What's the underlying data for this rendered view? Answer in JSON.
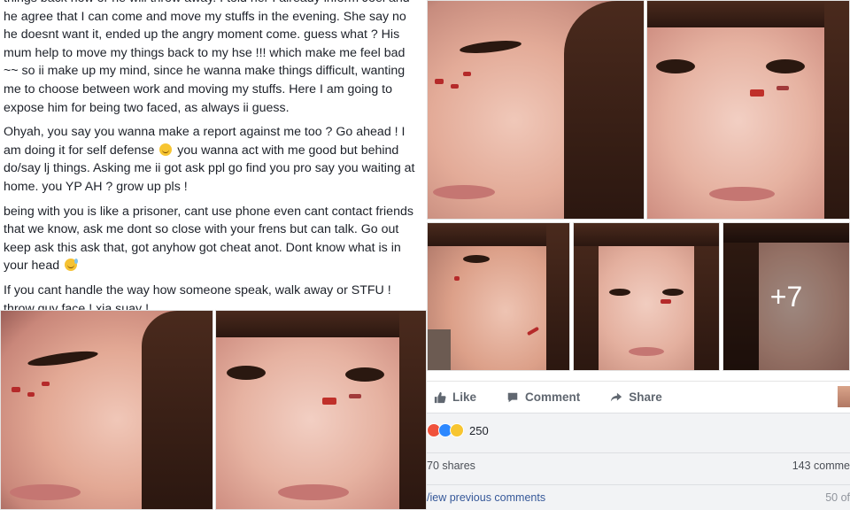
{
  "post": {
    "paragraphs": [
      "things back now or he will throw away. I told her I already inform Joel and he agree that I can come and move my stuffs in the evening. She say no he doesnt want it, ended up the angry moment come. guess what ? His mum help to move my things back to my hse !!! which make me feel bad ~~ so ii make up my mind, since he wanna make things difficult, wanting me to choose between work and moving my stuffs. Here I am going to expose him for being two faced, as always ii guess.",
      "Ohyah, you say you wanna make a report against me too ? Go ahead ! I am doing it for self defense",
      "you wanna act with me good but behind do/say lj things. Asking me ii got ask ppl go find you pro say you waiting at home. you YP AH ? grow up pls !",
      "being with you is like a prisoner, cant use phone even cant contact friends that we know, ask me dont so close with your frens but can talk. Go out keep ask this ask that, got anyhow got cheat anot. Dont know what is in your head",
      "If you cant handle the way how someone speak, walk away or STFU ! throw guy face ! xia suay !"
    ]
  },
  "gallery": {
    "more_count": "+7"
  },
  "actions": {
    "like": "Like",
    "comment": "Comment",
    "share": "Share"
  },
  "reactions": {
    "count": "250",
    "colors": [
      "#f0523c",
      "#2d88ff",
      "#f7c531"
    ]
  },
  "stats": {
    "shares": "70 shares",
    "comments": "143 comme"
  },
  "comments": {
    "view_previous": "/iew previous comments",
    "paging": "50 of"
  },
  "colors": {
    "text": "#1d2129",
    "muted": "#606770",
    "footer_bg": "#f2f3f5",
    "link": "#365899"
  }
}
